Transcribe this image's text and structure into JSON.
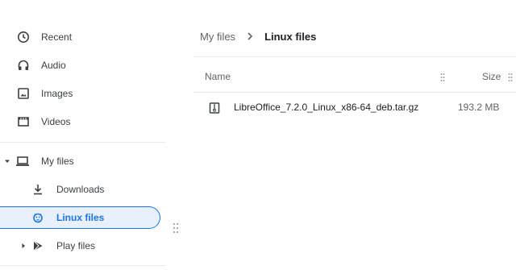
{
  "sidebar": {
    "items": [
      {
        "label": "Recent",
        "icon": "clock-icon"
      },
      {
        "label": "Audio",
        "icon": "headphones-icon"
      },
      {
        "label": "Images",
        "icon": "image-icon"
      },
      {
        "label": "Videos",
        "icon": "film-icon"
      },
      {
        "label": "My files",
        "icon": "laptop-icon"
      },
      {
        "label": "Downloads",
        "icon": "download-icon"
      },
      {
        "label": "Linux files",
        "icon": "linux-penguin-icon"
      },
      {
        "label": "Play files",
        "icon": "play-store-icon"
      }
    ]
  },
  "breadcrumb": {
    "root": "My files",
    "current": "Linux files"
  },
  "table": {
    "columns": [
      "Name",
      "Size"
    ],
    "rows": [
      {
        "name": "LibreOffice_7.2.0_Linux_x86-64_deb.tar.gz",
        "size": "193.2 MB",
        "icon": "archive-file-icon"
      }
    ]
  },
  "colors": {
    "accent": "#1a73e8",
    "selected_bg": "#e8f0fe",
    "icon_gray": "#5f6368"
  }
}
